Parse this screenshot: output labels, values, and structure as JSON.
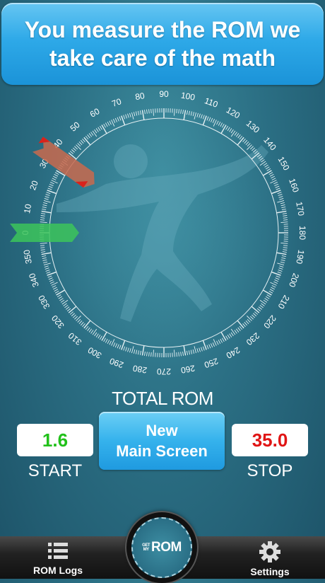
{
  "banner": {
    "text": "You measure the ROM we take care of the math"
  },
  "dial": {
    "tick_labels": [
      "0",
      "10",
      "20",
      "30",
      "40",
      "50",
      "60",
      "70",
      "80",
      "90",
      "100",
      "110",
      "120",
      "130",
      "140",
      "150",
      "160",
      "170",
      "180",
      "190",
      "200",
      "210",
      "220",
      "230",
      "240",
      "250",
      "260",
      "270",
      "280",
      "290",
      "300",
      "310",
      "320",
      "330",
      "340",
      "350"
    ],
    "start_marker_angle": 0,
    "stop_marker_angle": 35,
    "start_marker_color": "#3cc45a",
    "stop_marker_color": "#c96a4e"
  },
  "total_rom": {
    "label": "TOTAL ROM"
  },
  "start": {
    "value": "1.6",
    "label": "START",
    "color": "#22c11b"
  },
  "stop": {
    "value": "35.0",
    "label": "STOP",
    "color": "#e01515"
  },
  "new_button": {
    "line1": "New",
    "line2": "Main Screen"
  },
  "tabbar": {
    "left": {
      "label": "ROM Logs",
      "icon": "list-icon"
    },
    "center": {
      "logo_small_1": "GET",
      "logo_small_2": "MY",
      "logo_big": "ROM"
    },
    "right": {
      "label": "Settings",
      "icon": "gear-icon"
    }
  }
}
